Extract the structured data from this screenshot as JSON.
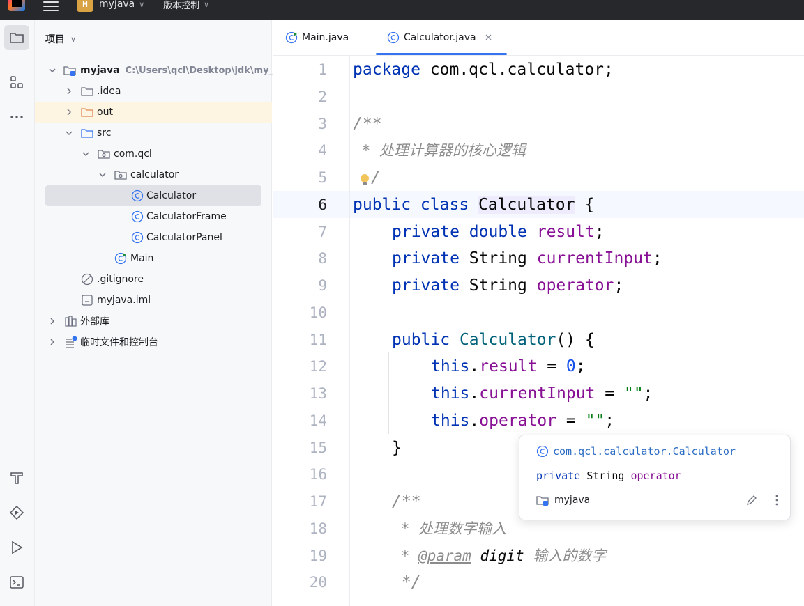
{
  "titlebar": {
    "project_badge": "M",
    "project_name": "myjava",
    "vcs_label": "版本控制"
  },
  "toolstrip": {
    "items": [
      "folder-icon",
      "structure-icon",
      "more-icon",
      "build-icon",
      "services-icon",
      "run-icon",
      "terminal-icon"
    ]
  },
  "project_panel": {
    "title": "项目",
    "tree": [
      {
        "label": "myjava",
        "path": "C:\\Users\\qcl\\Desktop\\jdk\\my_",
        "expanded": true,
        "icon": "module-folder-icon"
      },
      {
        "label": ".idea",
        "expanded": false,
        "icon": "folder-icon"
      },
      {
        "label": "out",
        "expanded": false,
        "icon": "excluded-folder-icon"
      },
      {
        "label": "src",
        "expanded": true,
        "icon": "source-folder-icon"
      },
      {
        "label": "com.qcl",
        "expanded": true,
        "icon": "package-icon"
      },
      {
        "label": "calculator",
        "expanded": true,
        "icon": "package-icon"
      },
      {
        "label": "Calculator",
        "icon": "java-class-icon",
        "selected": true
      },
      {
        "label": "CalculatorFrame",
        "icon": "java-class-icon"
      },
      {
        "label": "CalculatorPanel",
        "icon": "java-class-icon"
      },
      {
        "label": "Main",
        "icon": "java-main-class-icon"
      },
      {
        "label": ".gitignore",
        "icon": "ignored-file-icon"
      },
      {
        "label": "myjava.iml",
        "icon": "iml-file-icon"
      },
      {
        "label": "外部库",
        "expanded": false,
        "icon": "library-icon"
      },
      {
        "label": "临时文件和控制台",
        "expanded": false,
        "icon": "scratches-icon"
      }
    ]
  },
  "editor": {
    "tabs": [
      {
        "label": "Main.java",
        "active": false
      },
      {
        "label": "Calculator.java",
        "active": true,
        "close": "×"
      }
    ],
    "current_line": 6,
    "lines": [
      {
        "n": "1"
      },
      {
        "n": "2"
      },
      {
        "n": "3"
      },
      {
        "n": "4"
      },
      {
        "n": "5"
      },
      {
        "n": "6"
      },
      {
        "n": "7"
      },
      {
        "n": "8"
      },
      {
        "n": "9"
      },
      {
        "n": "10"
      },
      {
        "n": "11"
      },
      {
        "n": "12"
      },
      {
        "n": "13"
      },
      {
        "n": "14"
      },
      {
        "n": "15"
      },
      {
        "n": "16"
      },
      {
        "n": "17"
      },
      {
        "n": "18"
      },
      {
        "n": "19"
      },
      {
        "n": "20"
      }
    ],
    "code": {
      "l1": {
        "kw": "package",
        "rest": " com.qcl.calculator;"
      },
      "l3": "/**",
      "l4": " * 处理计算器的核心逻辑",
      "l5": "/",
      "l6": {
        "kw": "public class ",
        "cls": "Calculator",
        "rest": " {"
      },
      "l7": {
        "kw": "private double ",
        "fld": "result",
        "rest": ";"
      },
      "l8": {
        "kw": "private ",
        "type": "String ",
        "fld": "currentInput",
        "rest": ";"
      },
      "l9": {
        "kw": "private ",
        "type": "String ",
        "fld": "operator",
        "rest": ";"
      },
      "l11": {
        "kw": "public ",
        "fn": "Calculator",
        "rest": "() {"
      },
      "l12": {
        "kw": "this",
        "dot": ".",
        "fld": "result",
        "eq": " = ",
        "num": "0",
        "rest": ";"
      },
      "l13": {
        "kw": "this",
        "dot": ".",
        "fld": "currentInput",
        "eq": " = ",
        "str": "\"\"",
        "rest": ";"
      },
      "l14": {
        "kw": "this",
        "dot": ".",
        "fld": "operator",
        "eq": " = ",
        "str": "\"\"",
        "rest": ";"
      },
      "l15": "}",
      "l17": "/**",
      "l18": " * 处理数字输入",
      "l19": {
        "star": " * ",
        "tag": "@param",
        "param": " digit",
        "desc": " 输入的数字"
      },
      "l20": " */"
    }
  },
  "doc_popup": {
    "class_fqn": "com.qcl.calculator.Calculator",
    "sig_kw": "private",
    "sig_type": " String ",
    "sig_field": "operator",
    "module": "myjava"
  }
}
